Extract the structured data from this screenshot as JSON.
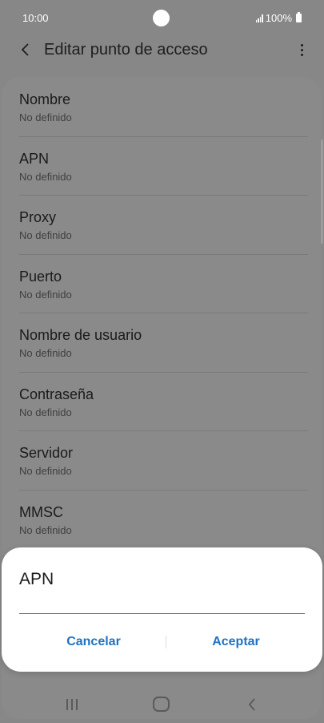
{
  "status_bar": {
    "time": "10:00",
    "battery": "100%"
  },
  "header": {
    "title": "Editar punto de acceso",
    "back_icon": "back-arrow-icon",
    "more_icon": "more-options-icon"
  },
  "list": {
    "items": [
      {
        "label": "Nombre",
        "value": "No definido"
      },
      {
        "label": "APN",
        "value": "No definido"
      },
      {
        "label": "Proxy",
        "value": "No definido"
      },
      {
        "label": "Puerto",
        "value": "No definido"
      },
      {
        "label": "Nombre de usuario",
        "value": "No definido"
      },
      {
        "label": "Contraseña",
        "value": "No definido"
      },
      {
        "label": "Servidor",
        "value": "No definido"
      },
      {
        "label": "MMSC",
        "value": "No definido"
      }
    ]
  },
  "dialog": {
    "title": "APN",
    "input_value": "",
    "cancel_label": "Cancelar",
    "accept_label": "Aceptar",
    "accent_color": "#1f72c4"
  },
  "nav_bar": {
    "recents_icon": "recents-icon",
    "home_icon": "home-icon",
    "back_icon": "nav-back-icon"
  }
}
